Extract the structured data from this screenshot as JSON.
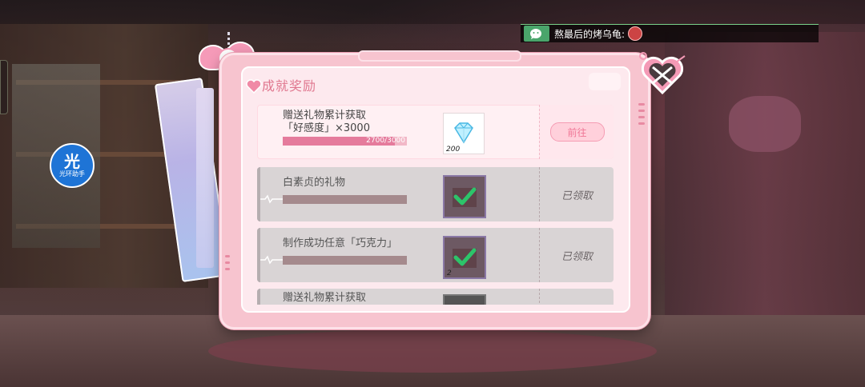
{
  "chat": {
    "message": "熬最后的烤乌龟:"
  },
  "assistant": {
    "big": "光",
    "label": "光环助手"
  },
  "modal": {
    "title": "成就奖励"
  },
  "achievements": [
    {
      "name_line1": "赠送礼物累计获取",
      "name_line2": "「好感度」×3000",
      "progress_text": "2700/3000",
      "progress": 0.9,
      "reward": "diamond-icon",
      "reward_qty": "200",
      "status": "active",
      "action": "前往"
    },
    {
      "name_line1": "白素贞的礼物",
      "name_line2": "",
      "progress": 1.0,
      "reward": "check-icon",
      "reward_qty": "",
      "status": "done",
      "action": "已领取"
    },
    {
      "name_line1": "制作成功任意「巧克力」",
      "name_line2": "",
      "progress": 1.0,
      "reward": "check-icon",
      "reward_qty": "2",
      "status": "done",
      "action": "已领取"
    },
    {
      "name_line1": "赠送礼物累计获取",
      "name_line2": "",
      "status": "partial"
    }
  ],
  "colors": {
    "accent_pink": "#e57b9c",
    "modal_bg": "#f7c4cf",
    "check_green": "#2dc46a"
  }
}
